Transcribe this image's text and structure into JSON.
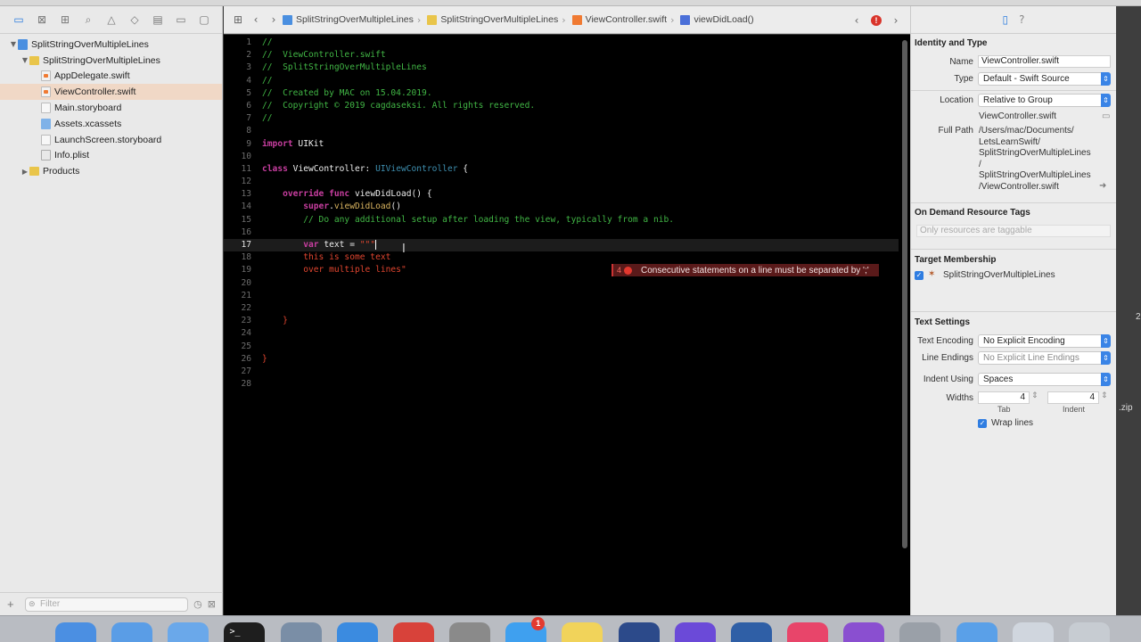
{
  "navigator": {
    "filter_placeholder": "Filter",
    "items": [
      {
        "label": "SplitStringOverMultipleLines",
        "kind": "proj",
        "indent": 0,
        "tri": "▼"
      },
      {
        "label": "SplitStringOverMultipleLines",
        "kind": "folder",
        "indent": 1,
        "tri": "▼"
      },
      {
        "label": "AppDelegate.swift",
        "kind": "swift",
        "indent": 2,
        "tri": ""
      },
      {
        "label": "ViewController.swift",
        "kind": "swift",
        "indent": 2,
        "tri": "",
        "selected": true
      },
      {
        "label": "Main.storyboard",
        "kind": "sb",
        "indent": 2,
        "tri": ""
      },
      {
        "label": "Assets.xcassets",
        "kind": "assets",
        "indent": 2,
        "tri": ""
      },
      {
        "label": "LaunchScreen.storyboard",
        "kind": "sb",
        "indent": 2,
        "tri": ""
      },
      {
        "label": "Info.plist",
        "kind": "plist",
        "indent": 2,
        "tri": ""
      },
      {
        "label": "Products",
        "kind": "folder",
        "indent": 1,
        "tri": "▶"
      }
    ]
  },
  "jumpbar": {
    "crumbs": [
      "SplitStringOverMultipleLines",
      "SplitStringOverMultipleLines",
      "ViewController.swift",
      "viewDidLoad()"
    ]
  },
  "editor": {
    "current_line": 17,
    "lines": [
      [
        [
          "c-comment",
          "//"
        ]
      ],
      [
        [
          "c-comment",
          "//  ViewController.swift"
        ]
      ],
      [
        [
          "c-comment",
          "//  SplitStringOverMultipleLines"
        ]
      ],
      [
        [
          "c-comment",
          "//"
        ]
      ],
      [
        [
          "c-comment",
          "//  Created by MAC on 15.04.2019."
        ]
      ],
      [
        [
          "c-comment",
          "//  Copyright © 2019 cagdaseksi. All rights reserved."
        ]
      ],
      [
        [
          "c-comment",
          "//"
        ]
      ],
      [],
      [
        [
          "c-kw",
          "import"
        ],
        [
          "c-plain",
          " UIKit"
        ]
      ],
      [],
      [
        [
          "c-kw",
          "class"
        ],
        [
          "c-plain",
          " ViewController: "
        ],
        [
          "c-type",
          "UIViewController"
        ],
        [
          "c-plain",
          " {"
        ]
      ],
      [],
      [
        [
          "c-plain",
          "    "
        ],
        [
          "c-kw",
          "override"
        ],
        [
          "c-plain",
          " "
        ],
        [
          "c-kw",
          "func"
        ],
        [
          "c-plain",
          " viewDidLoad() {"
        ]
      ],
      [
        [
          "c-plain",
          "        "
        ],
        [
          "c-kw",
          "super"
        ],
        [
          "c-plain",
          "."
        ],
        [
          "c-call",
          "viewDidLoad"
        ],
        [
          "c-plain",
          "()"
        ]
      ],
      [
        [
          "c-plain",
          "        "
        ],
        [
          "c-comment",
          "// Do any additional setup after loading the view, typically from a nib."
        ]
      ],
      [],
      [
        [
          "c-plain",
          "        "
        ],
        [
          "c-kw",
          "var"
        ],
        [
          "c-plain",
          " text = "
        ],
        [
          "c-str",
          "\"\"\""
        ],
        [
          "cursor",
          ""
        ]
      ],
      [
        [
          "c-plain",
          "        "
        ],
        [
          "c-str",
          "this is some text"
        ]
      ],
      [
        [
          "c-plain",
          "        "
        ],
        [
          "c-str",
          "over multiple lines\""
        ]
      ],
      [],
      [],
      [],
      [
        [
          "c-plain",
          "    "
        ],
        [
          "c-str",
          "}"
        ]
      ],
      [],
      [],
      [
        [
          "c-str",
          "}"
        ]
      ],
      [],
      []
    ],
    "error": {
      "count": "4",
      "message": "Consecutive statements on a line must be separated by ';'"
    }
  },
  "inspector": {
    "identity_title": "Identity and Type",
    "name_label": "Name",
    "name_value": "ViewController.swift",
    "type_label": "Type",
    "type_value": "Default - Swift Source",
    "location_label": "Location",
    "location_value": "Relative to Group",
    "location_file": "ViewController.swift",
    "fullpath_label": "Full Path",
    "fullpath_lines": [
      "/Users/mac/Documents/",
      "LetsLearnSwift/",
      "SplitStringOverMultipleLines",
      "/",
      "SplitStringOverMultipleLines",
      "/ViewController.swift"
    ],
    "odr_title": "On Demand Resource Tags",
    "odr_placeholder": "Only resources are taggable",
    "target_title": "Target Membership",
    "target_name": "SplitStringOverMultipleLines",
    "text_title": "Text Settings",
    "encoding_label": "Text Encoding",
    "encoding_value": "No Explicit Encoding",
    "endings_label": "Line Endings",
    "endings_value": "No Explicit Line Endings",
    "indent_label": "Indent Using",
    "indent_value": "Spaces",
    "widths_label": "Widths",
    "tab_value": "4",
    "indent_width_value": "4",
    "tab_caption": "Tab",
    "indent_caption": "Indent",
    "wrap_label": "Wrap lines"
  },
  "desktop_edge": {
    "labels": [
      "2",
      ".zip"
    ]
  },
  "dock": {
    "apps": [
      {
        "name": "finder",
        "color": "#4b8fe2"
      },
      {
        "name": "xcode-folder",
        "color": "#5a9de6"
      },
      {
        "name": "folder",
        "color": "#6aa8ea"
      },
      {
        "name": "terminal",
        "color": "#1e1e1e"
      },
      {
        "name": "launchpad",
        "color": "#7a8ea6"
      },
      {
        "name": "safari",
        "color": "#3b8be0"
      },
      {
        "name": "chrome",
        "color": "#d8423a"
      },
      {
        "name": "system-preferences",
        "color": "#8a8a8a"
      },
      {
        "name": "app-store",
        "color": "#3fa0ef",
        "badge": "1"
      },
      {
        "name": "notes",
        "color": "#f1d35a"
      },
      {
        "name": "quicktime",
        "color": "#2c4a8a"
      },
      {
        "name": "imovie",
        "color": "#6b4ad8"
      },
      {
        "name": "visual-studio",
        "color": "#2f5fa6"
      },
      {
        "name": "itunes",
        "color": "#e8456a"
      },
      {
        "name": "github",
        "color": "#8a4fd0"
      },
      {
        "name": "spotlight",
        "color": "#9aa0a8"
      },
      {
        "name": "downloads",
        "color": "#5aa0e8"
      },
      {
        "name": "preview",
        "color": "#d0d6de"
      },
      {
        "name": "trash",
        "color": "#c7ccd2"
      }
    ],
    "terminal_label": ">_"
  }
}
